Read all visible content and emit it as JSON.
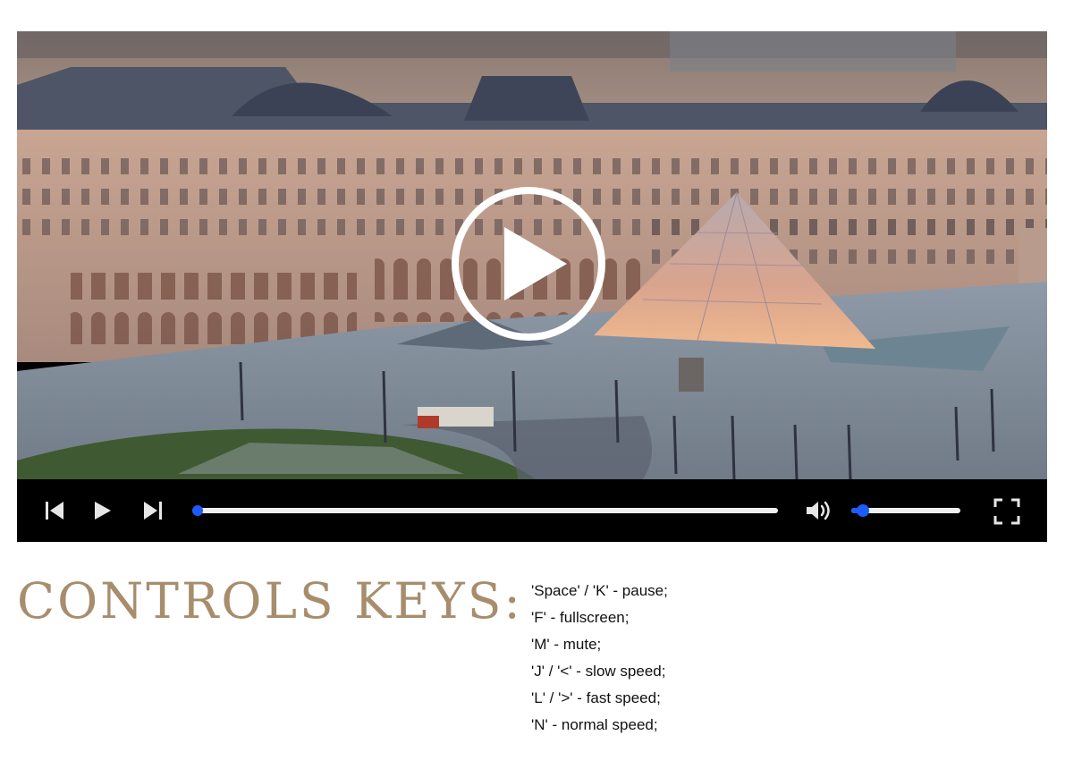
{
  "player": {
    "scene": "Louvre Museum courtyard with glass pyramid at dusk",
    "progress_fraction": 0.0,
    "volume_fraction": 0.1,
    "accent_color": "#1e5bff",
    "icons": {
      "previous": "skip-previous-icon",
      "play": "play-icon",
      "next": "skip-next-icon",
      "volume": "volume-icon",
      "fullscreen": "fullscreen-icon",
      "overlay": "play-circle-icon"
    }
  },
  "controls_section": {
    "heading": "Controls keys:",
    "heading_color": "#a78d6c",
    "keys": [
      "'Space' / 'K' - pause;",
      "'F' - fullscreen;",
      "'M' - mute;",
      "'J' / '<' - slow speed;",
      "'L' / '>' - fast speed;",
      "'N' - normal speed;"
    ]
  }
}
